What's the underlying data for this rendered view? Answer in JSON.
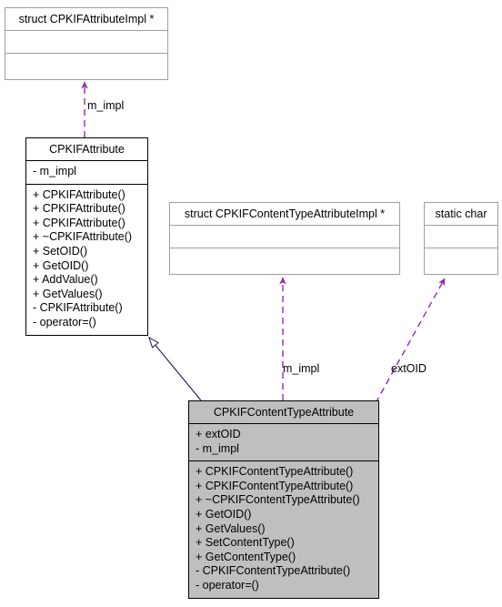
{
  "diagram": {
    "kind": "uml-class-diagram",
    "title": "CPKIFContentTypeAttribute collaboration diagram",
    "colors": {
      "background": "#ffffff",
      "node_fill": "#ffffff",
      "highlight_fill": "#bfbfbf",
      "node_border_gray": "#a0a0a0",
      "node_border_black": "#000000",
      "usage_edge": "#9428b4",
      "inheritance_edge": "#1a1a5e",
      "text": "#000000"
    }
  },
  "nodes": {
    "attribute_impl": {
      "name": "struct CPKIFAttributeImpl *",
      "attributes": [],
      "operations": []
    },
    "attribute": {
      "name": "CPKIFAttribute",
      "attributes": [
        "- m_impl"
      ],
      "operations": [
        "+ CPKIFAttribute()",
        "+ CPKIFAttribute()",
        "+ CPKIFAttribute()",
        "+ ~CPKIFAttribute()",
        "+ SetOID()",
        "+ GetOID()",
        "+ AddValue()",
        "+ GetValues()",
        "- CPKIFAttribute()",
        "- operator=()"
      ]
    },
    "content_type_attribute_impl": {
      "name": "struct CPKIFContentTypeAttributeImpl *",
      "attributes": [],
      "operations": []
    },
    "static_char": {
      "name": "static char",
      "attributes": [],
      "operations": []
    },
    "content_type_attribute": {
      "name": "CPKIFContentTypeAttribute",
      "attributes": [
        "+ extOID",
        "- m_impl"
      ],
      "operations": [
        "+ CPKIFContentTypeAttribute()",
        "+ CPKIFContentTypeAttribute()",
        "+ ~CPKIFContentTypeAttribute()",
        "+ GetOID()",
        "+ GetValues()",
        "+ SetContentType()",
        "+ GetContentType()",
        "- CPKIFContentTypeAttribute()",
        "- operator=()"
      ]
    }
  },
  "edges": [
    {
      "id": "attribute-to-attribute-impl",
      "from": "attribute",
      "to": "attribute_impl",
      "type": "usage",
      "style": "dashed",
      "label": "m_impl"
    },
    {
      "id": "contenttype-to-contenttype-impl",
      "from": "content_type_attribute",
      "to": "content_type_attribute_impl",
      "type": "usage",
      "style": "dashed",
      "label": "m_impl"
    },
    {
      "id": "contenttype-to-static-char",
      "from": "content_type_attribute",
      "to": "static_char",
      "type": "usage",
      "style": "dashed",
      "label": "extOID"
    },
    {
      "id": "contenttype-inherits-attribute",
      "from": "content_type_attribute",
      "to": "attribute",
      "type": "inheritance",
      "style": "solid",
      "label": ""
    }
  ]
}
